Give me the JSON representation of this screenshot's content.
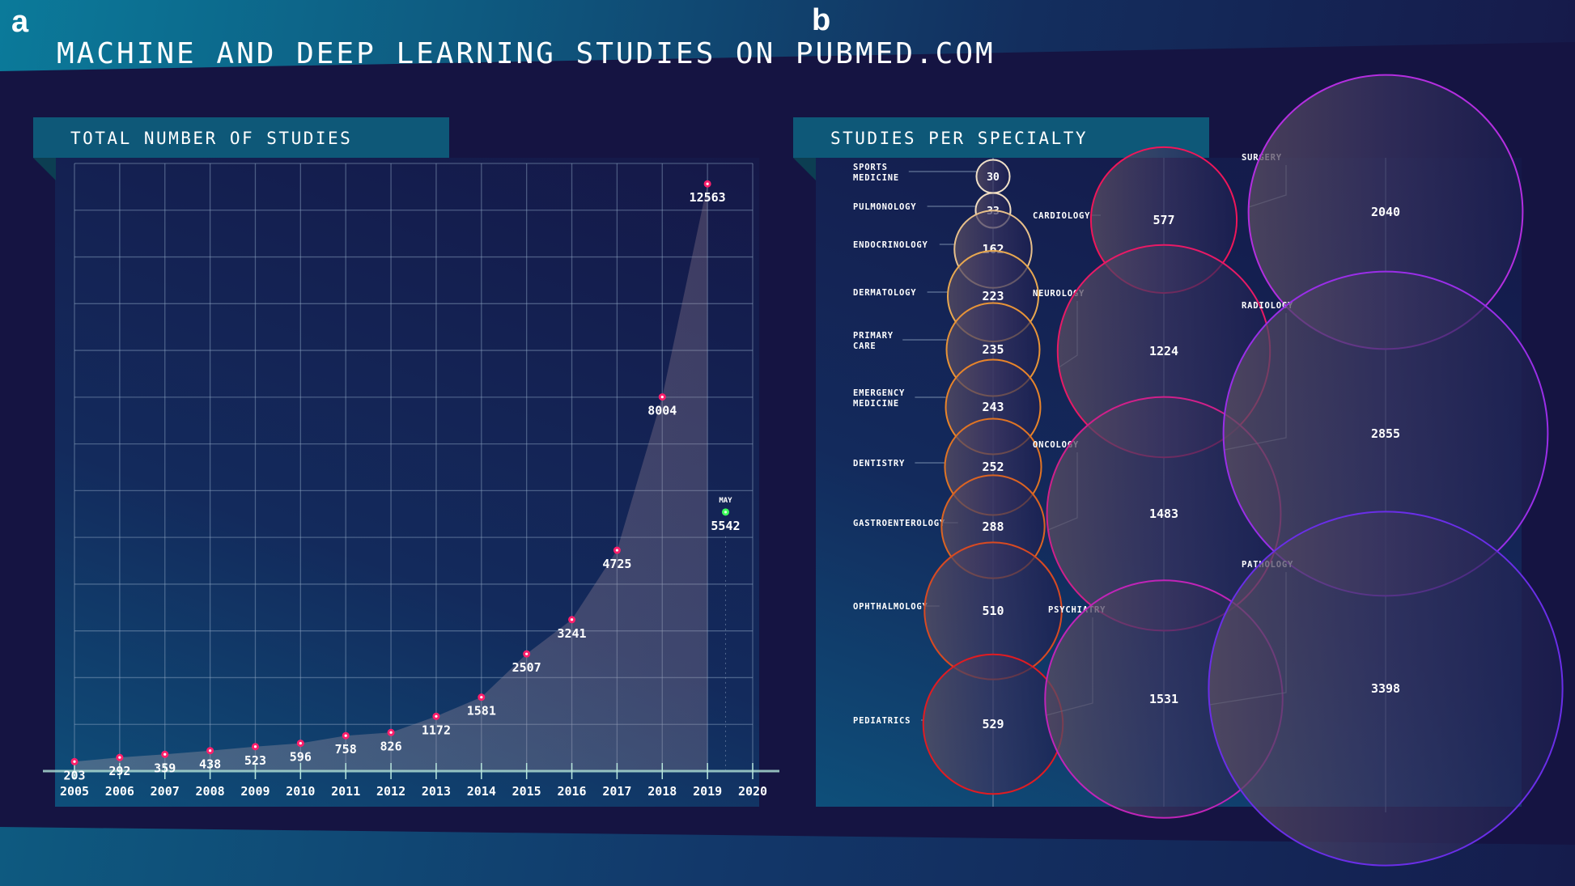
{
  "panel_labels": {
    "a": "a",
    "b": "b"
  },
  "title": "MACHINE AND DEEP LEARNING STUDIES ON PUBMED.COM",
  "colors": {
    "background": "#151442",
    "header": "#0e5878",
    "point": "#ff1f6b",
    "projection_point": "#3cff5a",
    "grid": "#8fa6c4",
    "area_fill": "#b49aa6"
  },
  "chart_data": [
    {
      "type": "area",
      "title": "TOTAL NUMBER OF STUDIES",
      "xlabel": "",
      "ylabel": "",
      "x_ticks": [
        "2005",
        "2006",
        "2007",
        "2008",
        "2009",
        "2010",
        "2011",
        "2012",
        "2013",
        "2014",
        "2015",
        "2016",
        "2017",
        "2018",
        "2019",
        "2020"
      ],
      "x": [
        2005,
        2006,
        2007,
        2008,
        2009,
        2010,
        2011,
        2012,
        2013,
        2014,
        2015,
        2016,
        2017,
        2018,
        2019
      ],
      "values": [
        203,
        292,
        359,
        438,
        523,
        596,
        758,
        826,
        1172,
        1581,
        2507,
        3241,
        4725,
        8004,
        12563
      ],
      "value_labels": [
        "203",
        "292",
        "359",
        "438",
        "523",
        "596",
        "758",
        "826",
        "1172",
        "1581",
        "2507",
        "3241",
        "4725",
        "8004",
        "12563"
      ],
      "annotation": {
        "x": 2019.4,
        "value": 5542,
        "label": "5542",
        "tag": "MAY"
      },
      "xlim": [
        2005,
        2020
      ],
      "ylim": [
        0,
        13000
      ],
      "y_grid_step": 1000,
      "grid": true,
      "y_tick_labels": false
    },
    {
      "type": "bubble",
      "title": "STUDIES PER SPECIALTY",
      "columns": [
        {
          "items": [
            {
              "name": "SPORTS MEDICINE",
              "value": 30,
              "color": "#f0e0c8"
            },
            {
              "name": "PULMONOLOGY",
              "value": 33,
              "color": "#f0dcc0"
            },
            {
              "name": "ENDOCRINOLOGY",
              "value": 162,
              "color": "#e8c08a"
            },
            {
              "name": "DERMATOLOGY",
              "value": 223,
              "color": "#e8a850"
            },
            {
              "name": "PRIMARY CARE",
              "value": 235,
              "color": "#e89438"
            },
            {
              "name": "EMERGENCY MEDICINE",
              "value": 243,
              "color": "#e8842a"
            },
            {
              "name": "DENTISTRY",
              "value": 252,
              "color": "#e07424"
            },
            {
              "name": "GASTROENTEROLOGY",
              "value": 288,
              "color": "#dc6422"
            },
            {
              "name": "OPHTHALMOLOGY",
              "value": 510,
              "color": "#d84a22"
            },
            {
              "name": "PEDIATRICS",
              "value": 529,
              "color": "#e01c22"
            }
          ]
        },
        {
          "items": [
            {
              "name": "CARDIOLOGY",
              "value": 577,
              "color": "#f0165a"
            },
            {
              "name": "NEUROLOGY",
              "value": 1224,
              "color": "#e81a66"
            },
            {
              "name": "ONCOLOGY",
              "value": 1483,
              "color": "#d0208a"
            },
            {
              "name": "PSYCHIATRY",
              "value": 1531,
              "color": "#c024b8"
            }
          ]
        },
        {
          "items": [
            {
              "name": "SURGERY",
              "value": 2040,
              "color": "#b42ee0"
            },
            {
              "name": "RADIOLOGY",
              "value": 2855,
              "color": "#9a2ee8"
            },
            {
              "name": "PATHOLOGY",
              "value": 3398,
              "color": "#6a2ee8"
            }
          ]
        }
      ]
    }
  ]
}
